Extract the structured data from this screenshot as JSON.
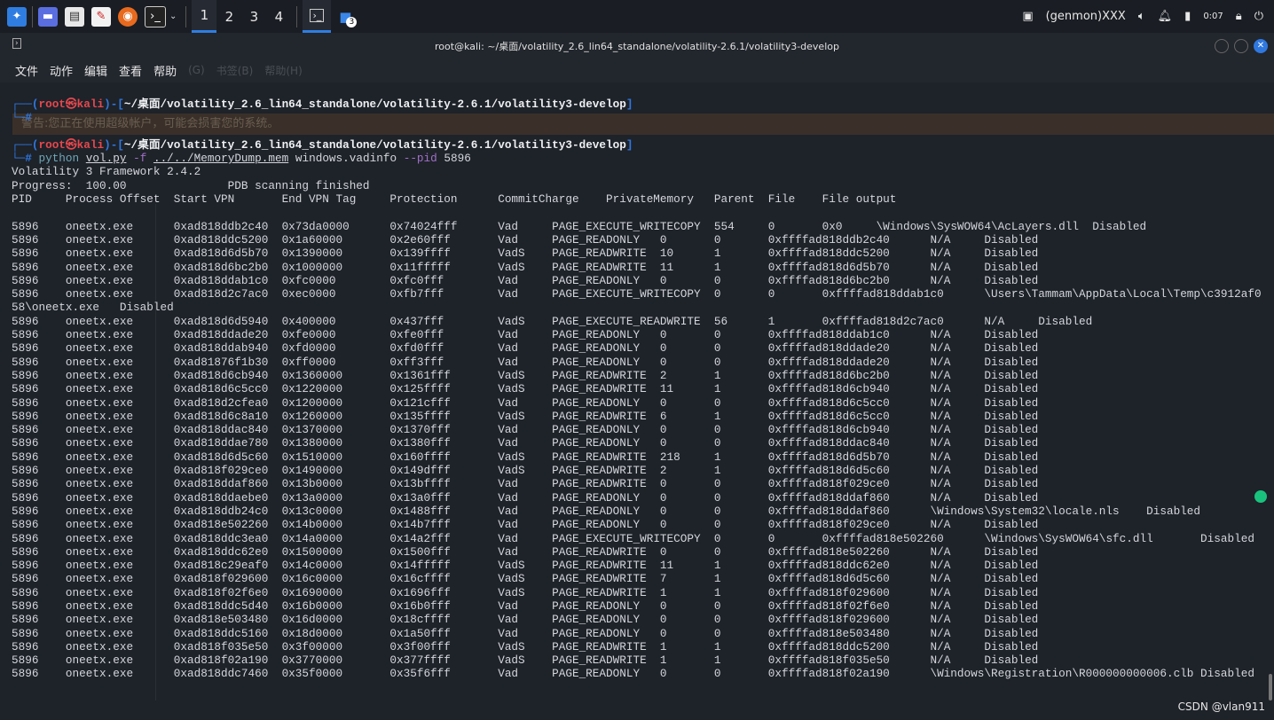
{
  "taskbar": {
    "workspaces": [
      "1",
      "2",
      "3",
      "4"
    ],
    "active_workspace": "1",
    "folder_badge": "3",
    "genmon": "(genmon)XXX",
    "clock": "0:07"
  },
  "window": {
    "title": "root@kali: ~/桌面/volatility_2.6_lin64_standalone/volatility-2.6.1/volatility3-develop"
  },
  "menu": [
    "文件",
    "动作",
    "编辑",
    "查看",
    "帮助"
  ],
  "background_menu_ghost": [
    "(G)",
    "书签(B)",
    "帮助(H)"
  ],
  "background_warning": "警告:您正在使用超级帐户，可能会损害您的系统。",
  "terminal": {
    "prompt_user": "root㉿kali",
    "prompt_path": "~/桌面/volatility_2.6_lin64_standalone/volatility-2.6.1/volatility3-develop",
    "command": {
      "program": "python",
      "script": "vol.py",
      "flag_f": "-f",
      "file": "../../MemoryDump.mem",
      "plugin": "windows.vadinfo",
      "flag_pid": "--pid",
      "pid": "5896"
    },
    "banner": "Volatility 3 Framework 2.4.2",
    "progress": "Progress:  100.00\t\tPDB scanning finished",
    "header": [
      "PID",
      "Process",
      "Offset",
      "Start VPN",
      "End VPN",
      "Tag",
      "Protection",
      "CommitCharge",
      "PrivateMemory",
      "Parent",
      "File",
      "File output"
    ],
    "rows": [
      [
        "5896",
        "oneetx.exe",
        "0xad818ddb2c40",
        "0x73da0000",
        "0x74024fff",
        "Vad",
        "PAGE_EXECUTE_WRITECOPY",
        "554",
        "0",
        "0x0",
        "\\Windows\\SysWOW64\\AcLayers.dll",
        "Disabled"
      ],
      [
        "5896",
        "oneetx.exe",
        "0xad818ddc5200",
        "0x1a60000",
        "0x2e60fff",
        "Vad",
        "PAGE_READONLY",
        "0",
        "0",
        "0xffffad818ddb2c40",
        "N/A",
        "Disabled"
      ],
      [
        "5896",
        "oneetx.exe",
        "0xad818d6d5b70",
        "0x1390000",
        "0x139ffff",
        "VadS",
        "PAGE_READWRITE",
        "10",
        "1",
        "0xffffad818ddc5200",
        "N/A",
        "Disabled"
      ],
      [
        "5896",
        "oneetx.exe",
        "0xad818d6bc2b0",
        "0x1000000",
        "0x11fffff",
        "VadS",
        "PAGE_READWRITE",
        "11",
        "1",
        "0xffffad818d6d5b70",
        "N/A",
        "Disabled"
      ],
      [
        "5896",
        "oneetx.exe",
        "0xad818ddab1c0",
        "0xfc0000",
        "0xfc0fff",
        "Vad",
        "PAGE_READONLY",
        "0",
        "0",
        "0xffffad818d6bc2b0",
        "N/A",
        "Disabled"
      ],
      [
        "5896",
        "oneetx.exe",
        "0xad818d2c7ac0",
        "0xec0000",
        "0xfb7fff",
        "Vad",
        "PAGE_EXECUTE_WRITECOPY",
        "0",
        "0",
        "0xffffad818ddab1c0",
        "\\Users\\Tammam\\AppData\\Local\\Temp\\c3912af058\\oneetx.exe",
        "Disabled"
      ],
      [
        "5896",
        "oneetx.exe",
        "0xad818d6d5940",
        "0x400000",
        "0x437fff",
        "VadS",
        "PAGE_EXECUTE_READWRITE",
        "56",
        "1",
        "0xffffad818d2c7ac0",
        "N/A",
        "Disabled"
      ],
      [
        "5896",
        "oneetx.exe",
        "0xad818ddade20",
        "0xfe0000",
        "0xfe0fff",
        "Vad",
        "PAGE_READONLY",
        "0",
        "0",
        "0xffffad818ddab1c0",
        "N/A",
        "Disabled"
      ],
      [
        "5896",
        "oneetx.exe",
        "0xad818ddab940",
        "0xfd0000",
        "0xfd0fff",
        "Vad",
        "PAGE_READONLY",
        "0",
        "0",
        "0xffffad818ddade20",
        "N/A",
        "Disabled"
      ],
      [
        "5896",
        "oneetx.exe",
        "0xad81876f1b30",
        "0xff0000",
        "0xff3fff",
        "Vad",
        "PAGE_READONLY",
        "0",
        "0",
        "0xffffad818ddade20",
        "N/A",
        "Disabled"
      ],
      [
        "5896",
        "oneetx.exe",
        "0xad818d6cb940",
        "0x1360000",
        "0x1361fff",
        "VadS",
        "PAGE_READWRITE",
        "2",
        "1",
        "0xffffad818d6bc2b0",
        "N/A",
        "Disabled"
      ],
      [
        "5896",
        "oneetx.exe",
        "0xad818d6c5cc0",
        "0x1220000",
        "0x125ffff",
        "VadS",
        "PAGE_READWRITE",
        "11",
        "1",
        "0xffffad818d6cb940",
        "N/A",
        "Disabled"
      ],
      [
        "5896",
        "oneetx.exe",
        "0xad818d2cfea0",
        "0x1200000",
        "0x121cfff",
        "Vad",
        "PAGE_READONLY",
        "0",
        "0",
        "0xffffad818d6c5cc0",
        "N/A",
        "Disabled"
      ],
      [
        "5896",
        "oneetx.exe",
        "0xad818d6c8a10",
        "0x1260000",
        "0x135ffff",
        "VadS",
        "PAGE_READWRITE",
        "6",
        "1",
        "0xffffad818d6c5cc0",
        "N/A",
        "Disabled"
      ],
      [
        "5896",
        "oneetx.exe",
        "0xad818ddac840",
        "0x1370000",
        "0x1370fff",
        "Vad",
        "PAGE_READONLY",
        "0",
        "0",
        "0xffffad818d6cb940",
        "N/A",
        "Disabled"
      ],
      [
        "5896",
        "oneetx.exe",
        "0xad818ddae780",
        "0x1380000",
        "0x1380fff",
        "Vad",
        "PAGE_READONLY",
        "0",
        "0",
        "0xffffad818ddac840",
        "N/A",
        "Disabled"
      ],
      [
        "5896",
        "oneetx.exe",
        "0xad818d6d5c60",
        "0x1510000",
        "0x160ffff",
        "VadS",
        "PAGE_READWRITE",
        "218",
        "1",
        "0xffffad818d6d5b70",
        "N/A",
        "Disabled"
      ],
      [
        "5896",
        "oneetx.exe",
        "0xad818f029ce0",
        "0x1490000",
        "0x149dfff",
        "VadS",
        "PAGE_READWRITE",
        "2",
        "1",
        "0xffffad818d6d5c60",
        "N/A",
        "Disabled"
      ],
      [
        "5896",
        "oneetx.exe",
        "0xad818ddaf860",
        "0x13b0000",
        "0x13bffff",
        "Vad",
        "PAGE_READWRITE",
        "0",
        "0",
        "0xffffad818f029ce0",
        "N/A",
        "Disabled"
      ],
      [
        "5896",
        "oneetx.exe",
        "0xad818ddaebe0",
        "0x13a0000",
        "0x13a0fff",
        "Vad",
        "PAGE_READONLY",
        "0",
        "0",
        "0xffffad818ddaf860",
        "N/A",
        "Disabled"
      ],
      [
        "5896",
        "oneetx.exe",
        "0xad818ddb24c0",
        "0x13c0000",
        "0x1488fff",
        "Vad",
        "PAGE_READONLY",
        "0",
        "0",
        "0xffffad818ddaf860",
        "\\Windows\\System32\\locale.nls",
        "Disabled"
      ],
      [
        "5896",
        "oneetx.exe",
        "0xad818e502260",
        "0x14b0000",
        "0x14b7fff",
        "Vad",
        "PAGE_READONLY",
        "0",
        "0",
        "0xffffad818f029ce0",
        "N/A",
        "Disabled"
      ],
      [
        "5896",
        "oneetx.exe",
        "0xad818ddc3ea0",
        "0x14a0000",
        "0x14a2fff",
        "Vad",
        "PAGE_EXECUTE_WRITECOPY",
        "0",
        "0",
        "0xffffad818e502260",
        "\\Windows\\SysWOW64\\sfc.dll",
        "Disabled"
      ],
      [
        "5896",
        "oneetx.exe",
        "0xad818ddc62e0",
        "0x1500000",
        "0x1500fff",
        "Vad",
        "PAGE_READWRITE",
        "0",
        "0",
        "0xffffad818e502260",
        "N/A",
        "Disabled"
      ],
      [
        "5896",
        "oneetx.exe",
        "0xad818c29eaf0",
        "0x14c0000",
        "0x14fffff",
        "VadS",
        "PAGE_READWRITE",
        "11",
        "1",
        "0xffffad818ddc62e0",
        "N/A",
        "Disabled"
      ],
      [
        "5896",
        "oneetx.exe",
        "0xad818f029600",
        "0x16c0000",
        "0x16cffff",
        "VadS",
        "PAGE_READWRITE",
        "7",
        "1",
        "0xffffad818d6d5c60",
        "N/A",
        "Disabled"
      ],
      [
        "5896",
        "oneetx.exe",
        "0xad818f02f6e0",
        "0x1690000",
        "0x1696fff",
        "VadS",
        "PAGE_READWRITE",
        "1",
        "1",
        "0xffffad818f029600",
        "N/A",
        "Disabled"
      ],
      [
        "5896",
        "oneetx.exe",
        "0xad818ddc5d40",
        "0x16b0000",
        "0x16b0fff",
        "Vad",
        "PAGE_READONLY",
        "0",
        "0",
        "0xffffad818f02f6e0",
        "N/A",
        "Disabled"
      ],
      [
        "5896",
        "oneetx.exe",
        "0xad818e503480",
        "0x16d0000",
        "0x18cffff",
        "Vad",
        "PAGE_READONLY",
        "0",
        "0",
        "0xffffad818f029600",
        "N/A",
        "Disabled"
      ],
      [
        "5896",
        "oneetx.exe",
        "0xad818ddc5160",
        "0x18d0000",
        "0x1a50fff",
        "Vad",
        "PAGE_READONLY",
        "0",
        "0",
        "0xffffad818e503480",
        "N/A",
        "Disabled"
      ],
      [
        "5896",
        "oneetx.exe",
        "0xad818f035e50",
        "0x3f00000",
        "0x3f00fff",
        "VadS",
        "PAGE_READWRITE",
        "1",
        "1",
        "0xffffad818ddc5200",
        "N/A",
        "Disabled"
      ],
      [
        "5896",
        "oneetx.exe",
        "0xad818f02a190",
        "0x3770000",
        "0x377ffff",
        "VadS",
        "PAGE_READWRITE",
        "1",
        "1",
        "0xffffad818f035e50",
        "N/A",
        "Disabled"
      ],
      [
        "5896",
        "oneetx.exe",
        "0xad818ddc7460",
        "0x35f0000",
        "0x35f6fff",
        "Vad",
        "PAGE_READONLY",
        "0",
        "0",
        "0xffffad818f02a190",
        "\\Windows\\Registration\\R000000000006.clb",
        "Disabled"
      ]
    ]
  },
  "watermark": "CSDN @vlan911",
  "colors": {
    "accent": "#2f78e0",
    "prompt_user": "#e5484d",
    "status_dot": "#19c37d"
  }
}
